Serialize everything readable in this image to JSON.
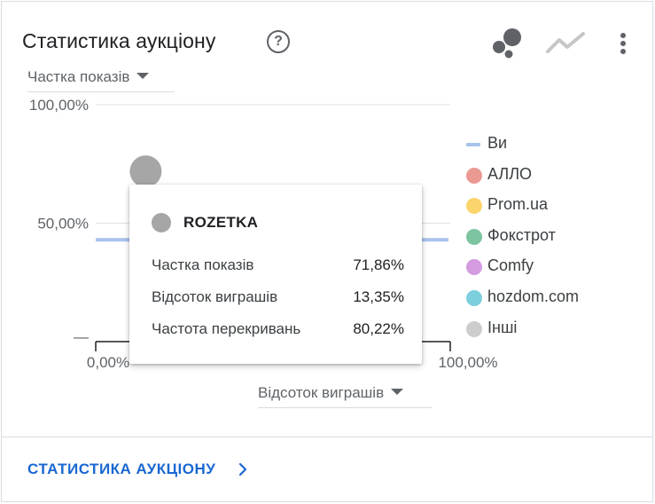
{
  "card": {
    "title": "Статистика аукціону",
    "help_glyph": "?"
  },
  "toolbar": {
    "bubble_icon": "bubble-chart-icon",
    "line_icon": "line-chart-icon",
    "more_icon": "more-vert-icon"
  },
  "y_dropdown": {
    "selected": "Частка показів"
  },
  "x_dropdown": {
    "selected": "Відсоток виграшів"
  },
  "chart_data": {
    "type": "scatter",
    "x_ticks": [
      "0,00%",
      "100,00%"
    ],
    "y_ticks": [
      "100,00%",
      "50,00%",
      "—"
    ],
    "xlim": [
      0,
      100
    ],
    "ylim": [
      0,
      100
    ],
    "reference_line": {
      "name": "Ви",
      "y": 43,
      "color": "#a8c3ec"
    },
    "points": [
      {
        "name": "ROZETKA",
        "x": 13.35,
        "y": 71.86,
        "color": "#a6a6a6"
      }
    ]
  },
  "tooltip": {
    "name": "ROZETKA",
    "color": "#a6a6a6",
    "rows": [
      {
        "label": "Частка показів",
        "value": "71,86%"
      },
      {
        "label": "Відсоток виграшів",
        "value": "13,35%"
      },
      {
        "label": "Частота перекривань",
        "value": "80,22%"
      }
    ]
  },
  "legend": [
    {
      "label": "Ви",
      "color": "#a8c3ec",
      "shape": "line"
    },
    {
      "label": "АЛЛО",
      "color": "#eb9a93",
      "shape": "dot"
    },
    {
      "label": "Prom.ua",
      "color": "#fbd46d",
      "shape": "dot"
    },
    {
      "label": "Фокстрот",
      "color": "#7cc3a0",
      "shape": "dot"
    },
    {
      "label": "Comfy",
      "color": "#d49be0",
      "shape": "dot"
    },
    {
      "label": "hozdom.com",
      "color": "#7ccfdc",
      "shape": "dot"
    },
    {
      "label": "Інші",
      "color": "#cdcdcd",
      "shape": "dot"
    }
  ],
  "footer": {
    "link_label": "СТАТИСТИКА АУКЦІОНУ"
  }
}
